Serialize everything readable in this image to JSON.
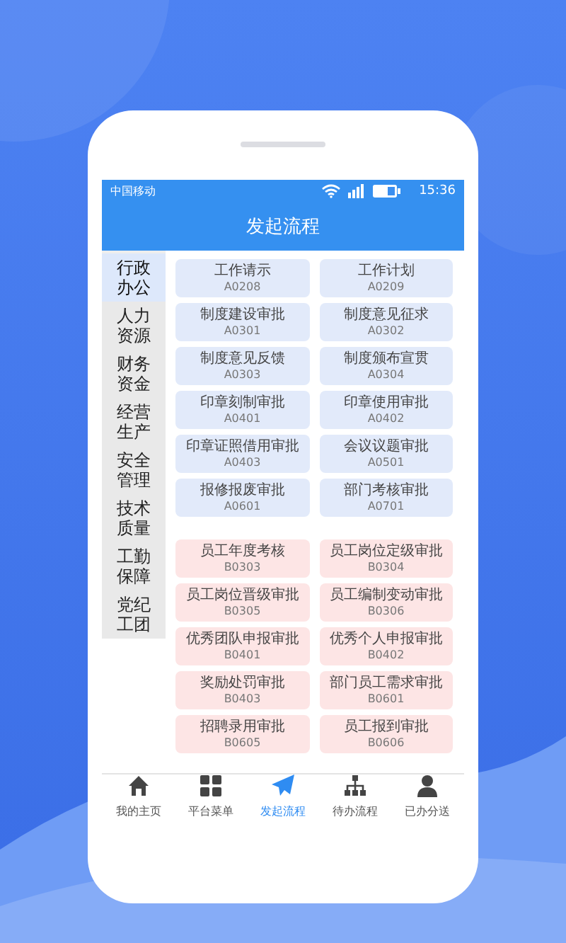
{
  "status_bar": {
    "carrier": "中国移动",
    "time": "15:36"
  },
  "header": {
    "title": "发起流程"
  },
  "sidebar": {
    "items": [
      {
        "label": "行政办公",
        "selected": true
      },
      {
        "label": "人力资源",
        "selected": false
      },
      {
        "label": "财务资金",
        "selected": false
      },
      {
        "label": "经营生产",
        "selected": false
      },
      {
        "label": "安全管理",
        "selected": false
      },
      {
        "label": "技术质量",
        "selected": false
      },
      {
        "label": "工勤保障",
        "selected": false
      },
      {
        "label": "党纪工团",
        "selected": false
      }
    ]
  },
  "groups": [
    {
      "color": "#e2eafa",
      "items": [
        {
          "title": "工作请示",
          "code": "A0208"
        },
        {
          "title": "工作计划",
          "code": "A0209"
        },
        {
          "title": "制度建设审批",
          "code": "A0301"
        },
        {
          "title": "制度意见征求",
          "code": "A0302"
        },
        {
          "title": "制度意见反馈",
          "code": "A0303"
        },
        {
          "title": "制度颁布宣贯",
          "code": "A0304"
        },
        {
          "title": "印章刻制审批",
          "code": "A0401"
        },
        {
          "title": "印章使用审批",
          "code": "A0402"
        },
        {
          "title": "印章证照借用审批",
          "code": "A0403"
        },
        {
          "title": "会议议题审批",
          "code": "A0501"
        },
        {
          "title": "报修报废审批",
          "code": "A0601"
        },
        {
          "title": "部门考核审批",
          "code": "A0701"
        }
      ]
    },
    {
      "color": "#fde5e5",
      "items": [
        {
          "title": "员工年度考核",
          "code": "B0303"
        },
        {
          "title": "员工岗位定级审批",
          "code": "B0304"
        },
        {
          "title": "员工岗位晋级审批",
          "code": "B0305"
        },
        {
          "title": "员工编制变动审批",
          "code": "B0306"
        },
        {
          "title": "优秀团队申报审批",
          "code": "B0401"
        },
        {
          "title": "优秀个人申报审批",
          "code": "B0402"
        },
        {
          "title": "奖励处罚审批",
          "code": "B0403"
        },
        {
          "title": "部门员工需求审批",
          "code": "B0601"
        },
        {
          "title": "招聘录用审批",
          "code": "B0605"
        },
        {
          "title": "员工报到审批",
          "code": "B0606"
        }
      ]
    }
  ],
  "tab_bar": [
    {
      "label": "我的主页",
      "kind": "home",
      "selected": false
    },
    {
      "label": "平台菜单",
      "kind": "grid",
      "selected": false
    },
    {
      "label": "发起流程",
      "kind": "send",
      "selected": true
    },
    {
      "label": "待办流程",
      "kind": "tree",
      "selected": false
    },
    {
      "label": "已办分送",
      "kind": "person",
      "selected": false
    }
  ]
}
